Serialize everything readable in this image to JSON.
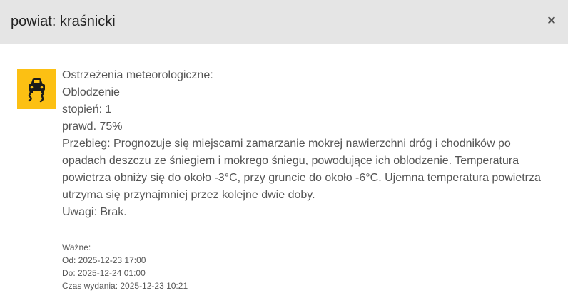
{
  "dialog": {
    "title": "powiat: kraśnicki",
    "close_label": "×"
  },
  "warning": {
    "icon": "slippery-road-icon",
    "icon_color": "#fcc013",
    "heading": "Ostrzeżenia meteorologiczne:",
    "name": "Oblodzenie",
    "level": "stopień: 1",
    "probability": "prawd. 75%",
    "course": "Przebieg: Prognozuje się miejscami zamarzanie mokrej nawierzchni dróg i chodników po opadach deszczu ze śniegiem i mokrego śniegu, powodujące ich oblodzenie. Temperatura powietrza obniży się do około -3°C, przy gruncie do około -6°C. Ujemna temperatura powietrza utrzyma się przynajmniej przez kolejne dwie doby.",
    "remarks": "Uwagi: Brak."
  },
  "validity": {
    "label": "Ważne:",
    "from": "Od: 2025-12-23 17:00",
    "to": "Do: 2025-12-24 01:00",
    "issued": "Czas wydania: 2025-12-23 10:21"
  }
}
